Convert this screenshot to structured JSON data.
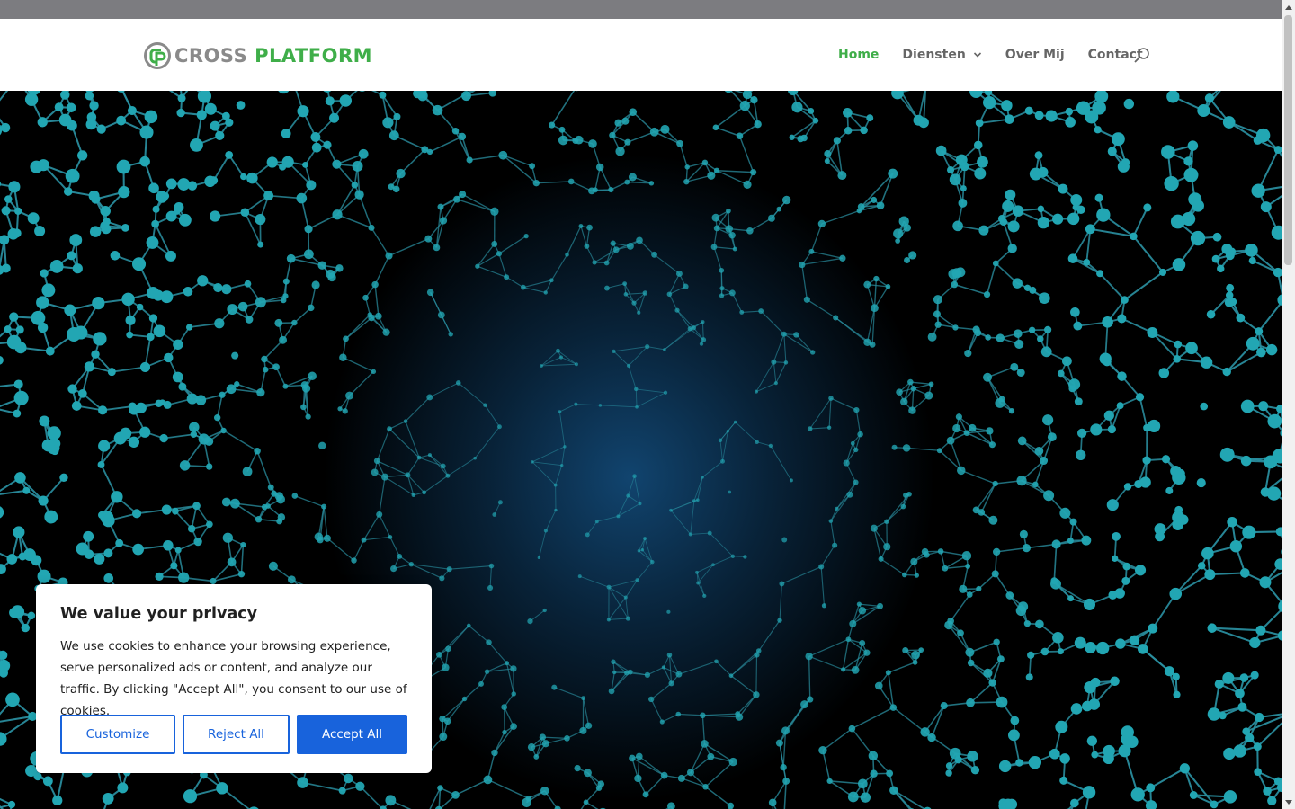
{
  "brand": {
    "name_part1": "CROSS",
    "name_part2": "PLATFORM",
    "grey": "#8a8a8a",
    "green": "#3fae49"
  },
  "nav": {
    "items": [
      {
        "label": "Home",
        "active": true
      },
      {
        "label": "Diensten",
        "has_dropdown": true
      },
      {
        "label": "Over Mij"
      },
      {
        "label": "Contact"
      }
    ],
    "search_icon": "search-icon"
  },
  "cookie_banner": {
    "title": "We value your privacy",
    "text": "We use cookies to enhance your browsing experience, serve personalized ads or content, and analyze our traffic. By clicking \"Accept All\", you consent to our use of cookies.",
    "customize_label": "Customize",
    "reject_label": "Reject All",
    "accept_label": "Accept All",
    "accent": "#1863dc"
  },
  "hero": {
    "node_color": "#22a6b3"
  }
}
